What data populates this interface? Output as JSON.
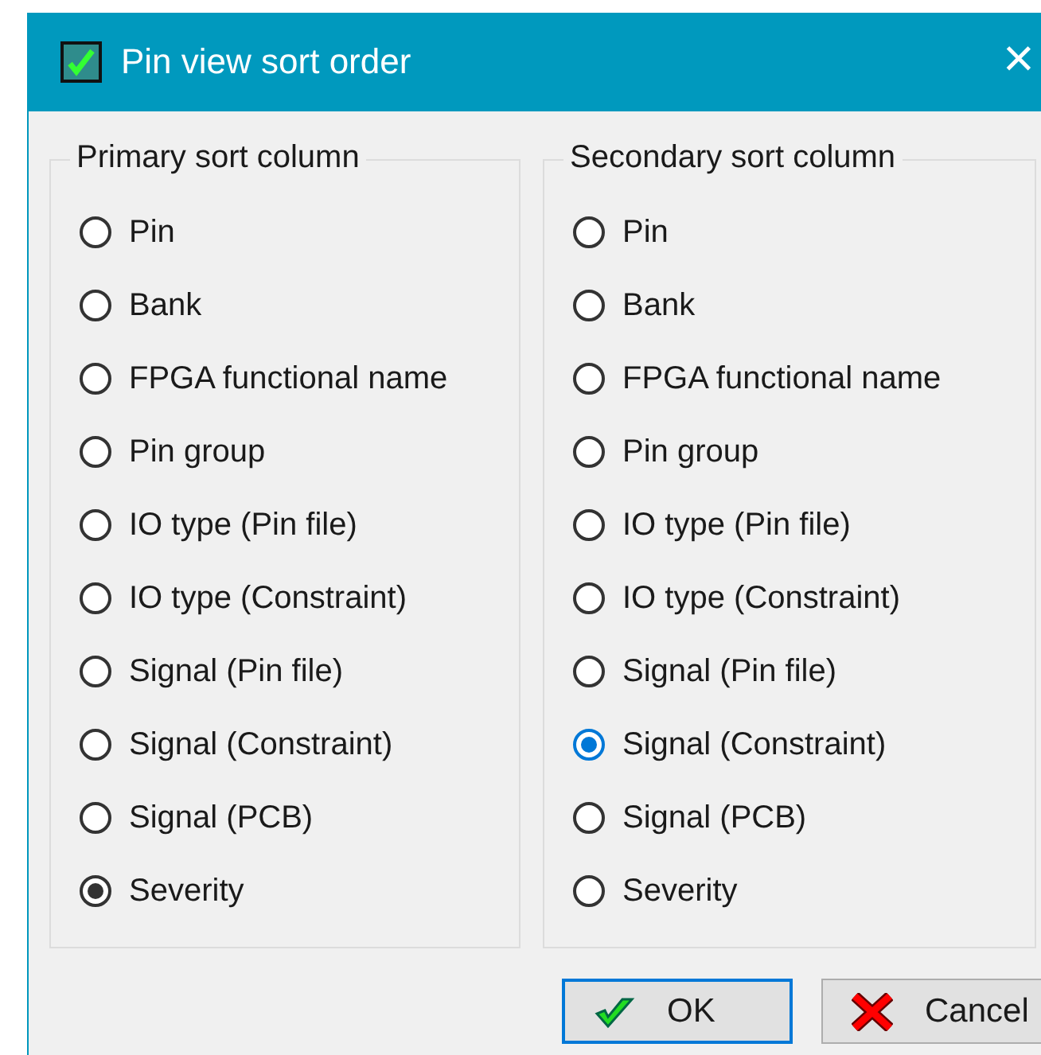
{
  "window": {
    "title": "Pin view sort order",
    "close": "×"
  },
  "groups": [
    {
      "title": "Primary sort column",
      "focused": false,
      "options": [
        {
          "label": "Pin",
          "selected": false
        },
        {
          "label": "Bank",
          "selected": false
        },
        {
          "label": "FPGA functional name",
          "selected": false
        },
        {
          "label": "Pin group",
          "selected": false
        },
        {
          "label": "IO type (Pin file)",
          "selected": false
        },
        {
          "label": "IO type (Constraint)",
          "selected": false
        },
        {
          "label": "Signal (Pin file)",
          "selected": false
        },
        {
          "label": "Signal (Constraint)",
          "selected": false
        },
        {
          "label": "Signal (PCB)",
          "selected": false
        },
        {
          "label": "Severity",
          "selected": true
        }
      ]
    },
    {
      "title": "Secondary sort column",
      "focused": true,
      "options": [
        {
          "label": "Pin",
          "selected": false
        },
        {
          "label": "Bank",
          "selected": false
        },
        {
          "label": "FPGA functional name",
          "selected": false
        },
        {
          "label": "Pin group",
          "selected": false
        },
        {
          "label": "IO type (Pin file)",
          "selected": false
        },
        {
          "label": "IO type (Constraint)",
          "selected": false
        },
        {
          "label": "Signal (Pin file)",
          "selected": false
        },
        {
          "label": "Signal (Constraint)",
          "selected": true
        },
        {
          "label": "Signal (PCB)",
          "selected": false
        },
        {
          "label": "Severity",
          "selected": false
        }
      ]
    }
  ],
  "buttons": [
    {
      "kind": "ok",
      "label": "OK",
      "default": true
    },
    {
      "kind": "cancel",
      "label": "Cancel",
      "default": false
    }
  ]
}
